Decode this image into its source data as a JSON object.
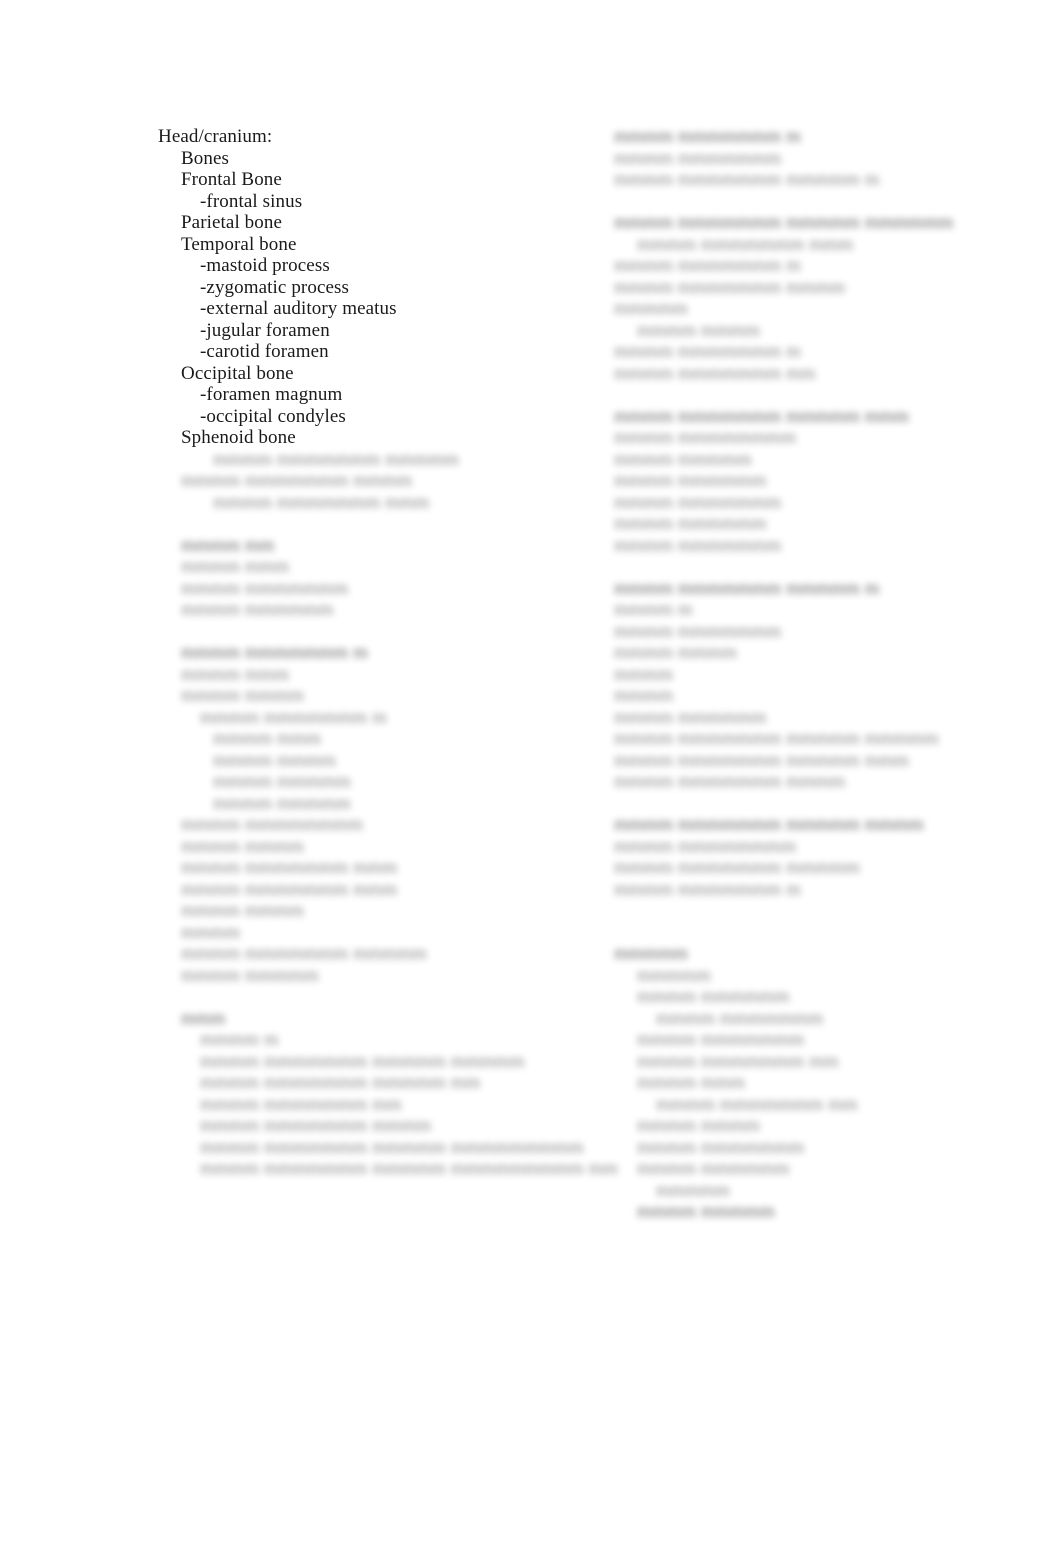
{
  "document": {
    "type": "study-outline",
    "background_color": "#ffffff",
    "text_color": "#1a1a1a",
    "blurred_text_color": "#5e5e5e",
    "font_size_px": 19,
    "note": "Two-column anatomy study outline. Only the upper-left section is in sharp focus; all remaining text in both columns is blurred and illegible."
  },
  "left_column": {
    "legible": [
      {
        "indent": 0,
        "text": "Head/cranium:"
      },
      {
        "indent": 1,
        "text": "Bones"
      },
      {
        "indent": 1,
        "text": "Frontal Bone"
      },
      {
        "indent": 2,
        "text": "-frontal sinus"
      },
      {
        "indent": 1,
        "text": "Parietal bone"
      },
      {
        "indent": 1,
        "text": "Temporal bone"
      },
      {
        "indent": 2,
        "text": "-mastoid process"
      },
      {
        "indent": 2,
        "text": "-zygomatic process"
      },
      {
        "indent": 2,
        "text": "-external auditory meatus"
      },
      {
        "indent": 2,
        "text": "-jugular foramen"
      },
      {
        "indent": 2,
        "text": "-carotid foramen"
      },
      {
        "indent": 1,
        "text": "Occipital bone"
      },
      {
        "indent": 2,
        "text": "-foramen magnum"
      },
      {
        "indent": 2,
        "text": "-occipital condyles"
      },
      {
        "indent": 1,
        "text": "Sphenoid bone"
      }
    ],
    "blurred": [
      {
        "indent": 3,
        "width_ch": 18,
        "kind": "body"
      },
      {
        "indent": 1,
        "width_ch": 17,
        "kind": "body"
      },
      {
        "indent": 3,
        "width_ch": 16,
        "kind": "body"
      },
      {
        "indent": 0,
        "width_ch": 0,
        "kind": "gap"
      },
      {
        "indent": 1,
        "width_ch": 7,
        "kind": "hdr"
      },
      {
        "indent": 1,
        "width_ch": 8,
        "kind": "body"
      },
      {
        "indent": 1,
        "width_ch": 12,
        "kind": "body"
      },
      {
        "indent": 1,
        "width_ch": 11,
        "kind": "body"
      },
      {
        "indent": 0,
        "width_ch": 0,
        "kind": "gap"
      },
      {
        "indent": 1,
        "width_ch": 14,
        "kind": "hdr"
      },
      {
        "indent": 1,
        "width_ch": 8,
        "kind": "body"
      },
      {
        "indent": 1,
        "width_ch": 9,
        "kind": "body"
      },
      {
        "indent": 2,
        "width_ch": 14,
        "kind": "body"
      },
      {
        "indent": 3,
        "width_ch": 8,
        "kind": "body"
      },
      {
        "indent": 3,
        "width_ch": 9,
        "kind": "body"
      },
      {
        "indent": 3,
        "width_ch": 10,
        "kind": "body"
      },
      {
        "indent": 3,
        "width_ch": 10,
        "kind": "body"
      },
      {
        "indent": 1,
        "width_ch": 13,
        "kind": "body"
      },
      {
        "indent": 1,
        "width_ch": 9,
        "kind": "body"
      },
      {
        "indent": 1,
        "width_ch": 16,
        "kind": "body"
      },
      {
        "indent": 1,
        "width_ch": 16,
        "kind": "body"
      },
      {
        "indent": 1,
        "width_ch": 9,
        "kind": "body"
      },
      {
        "indent": 1,
        "width_ch": 4,
        "kind": "body"
      },
      {
        "indent": 1,
        "width_ch": 18,
        "kind": "body"
      },
      {
        "indent": 1,
        "width_ch": 10,
        "kind": "body"
      },
      {
        "indent": 0,
        "width_ch": 0,
        "kind": "gap"
      },
      {
        "indent": 1,
        "width_ch": 3,
        "kind": "hdr"
      },
      {
        "indent": 2,
        "width_ch": 6,
        "kind": "body"
      },
      {
        "indent": 2,
        "width_ch": 24,
        "kind": "body"
      },
      {
        "indent": 2,
        "width_ch": 21,
        "kind": "body"
      },
      {
        "indent": 2,
        "width_ch": 15,
        "kind": "body"
      },
      {
        "indent": 2,
        "width_ch": 17,
        "kind": "body"
      },
      {
        "indent": 2,
        "width_ch": 28,
        "kind": "body"
      },
      {
        "indent": 2,
        "width_ch": 31,
        "kind": "body"
      }
    ]
  },
  "right_column": {
    "blurred": [
      {
        "indent": 0,
        "width_ch": 14,
        "kind": "hdr"
      },
      {
        "indent": 0,
        "width_ch": 12,
        "kind": "body"
      },
      {
        "indent": 0,
        "width_ch": 20,
        "kind": "body"
      },
      {
        "indent": 0,
        "width_ch": 0,
        "kind": "gap"
      },
      {
        "indent": 0,
        "width_ch": 25,
        "kind": "hdr"
      },
      {
        "indent": 1,
        "width_ch": 16,
        "kind": "body"
      },
      {
        "indent": 0,
        "width_ch": 14,
        "kind": "body"
      },
      {
        "indent": 0,
        "width_ch": 17,
        "kind": "body"
      },
      {
        "indent": 0,
        "width_ch": 5,
        "kind": "body"
      },
      {
        "indent": 1,
        "width_ch": 9,
        "kind": "body"
      },
      {
        "indent": 0,
        "width_ch": 14,
        "kind": "body"
      },
      {
        "indent": 0,
        "width_ch": 15,
        "kind": "body"
      },
      {
        "indent": 0,
        "width_ch": 0,
        "kind": "gap"
      },
      {
        "indent": 0,
        "width_ch": 22,
        "kind": "hdr"
      },
      {
        "indent": 0,
        "width_ch": 13,
        "kind": "body"
      },
      {
        "indent": 0,
        "width_ch": 10,
        "kind": "body"
      },
      {
        "indent": 0,
        "width_ch": 11,
        "kind": "body"
      },
      {
        "indent": 0,
        "width_ch": 12,
        "kind": "body"
      },
      {
        "indent": 0,
        "width_ch": 11,
        "kind": "body"
      },
      {
        "indent": 0,
        "width_ch": 12,
        "kind": "body"
      },
      {
        "indent": 0,
        "width_ch": 0,
        "kind": "gap"
      },
      {
        "indent": 0,
        "width_ch": 20,
        "kind": "hdr"
      },
      {
        "indent": 0,
        "width_ch": 6,
        "kind": "body"
      },
      {
        "indent": 0,
        "width_ch": 12,
        "kind": "body"
      },
      {
        "indent": 0,
        "width_ch": 9,
        "kind": "body"
      },
      {
        "indent": 0,
        "width_ch": 4,
        "kind": "body"
      },
      {
        "indent": 0,
        "width_ch": 4,
        "kind": "body"
      },
      {
        "indent": 0,
        "width_ch": 11,
        "kind": "body"
      },
      {
        "indent": 0,
        "width_ch": 24,
        "kind": "body"
      },
      {
        "indent": 0,
        "width_ch": 22,
        "kind": "body"
      },
      {
        "indent": 0,
        "width_ch": 17,
        "kind": "body"
      },
      {
        "indent": 0,
        "width_ch": 0,
        "kind": "gap"
      },
      {
        "indent": 0,
        "width_ch": 23,
        "kind": "hdr"
      },
      {
        "indent": 0,
        "width_ch": 13,
        "kind": "body"
      },
      {
        "indent": 0,
        "width_ch": 18,
        "kind": "body"
      },
      {
        "indent": 0,
        "width_ch": 14,
        "kind": "body"
      },
      {
        "indent": 0,
        "width_ch": 0,
        "kind": "gap"
      },
      {
        "indent": 0,
        "width_ch": 0,
        "kind": "gap"
      },
      {
        "indent": 0,
        "width_ch": 5,
        "kind": "hdr"
      },
      {
        "indent": 1,
        "width_ch": 5,
        "kind": "body"
      },
      {
        "indent": 1,
        "width_ch": 11,
        "kind": "body"
      },
      {
        "indent": 2,
        "width_ch": 12,
        "kind": "body"
      },
      {
        "indent": 1,
        "width_ch": 12,
        "kind": "body"
      },
      {
        "indent": 1,
        "width_ch": 15,
        "kind": "body"
      },
      {
        "indent": 1,
        "width_ch": 8,
        "kind": "body"
      },
      {
        "indent": 2,
        "width_ch": 15,
        "kind": "body"
      },
      {
        "indent": 1,
        "width_ch": 9,
        "kind": "body"
      },
      {
        "indent": 1,
        "width_ch": 12,
        "kind": "body"
      },
      {
        "indent": 1,
        "width_ch": 11,
        "kind": "body"
      },
      {
        "indent": 2,
        "width_ch": 5,
        "kind": "body"
      },
      {
        "indent": 1,
        "width_ch": 10,
        "kind": "hdr"
      }
    ]
  }
}
